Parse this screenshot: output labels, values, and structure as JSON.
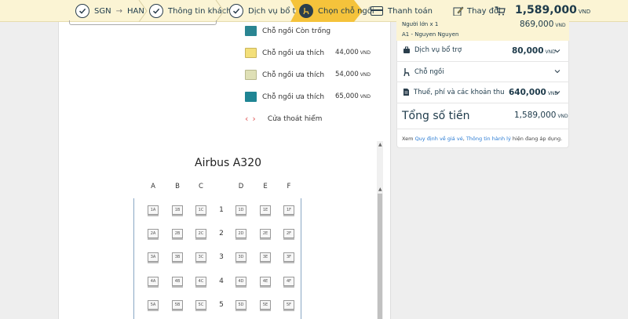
{
  "steps": {
    "route_from": "SGN",
    "route_to": "HAN",
    "passenger_info": "Thông tin khách",
    "extra_services": "Dịch vụ bổ trợ",
    "choose_seat": "Chọn chỗ ngồi",
    "payment": "Thanh toán",
    "change": "Thay đổi",
    "total": "1,589,000",
    "currency": "VND"
  },
  "legend": [
    {
      "label": "Chỗ ngồi Còn trống",
      "color": "#2a8592",
      "price": ""
    },
    {
      "label": "Chỗ ngồi ưa thích",
      "color": "#f3df7a",
      "price": "44,000"
    },
    {
      "label": "Chỗ ngồi ưa thích",
      "color": "#dfe0b6",
      "price": "54,000"
    },
    {
      "label": "Chỗ ngồi ưa thích",
      "color": "#1f8594",
      "price": "65,000"
    }
  ],
  "exit_label": "Cửa thoát hiểm",
  "aircraft": "Airbus A320",
  "columns": [
    "A",
    "B",
    "C",
    "D",
    "E",
    "F"
  ],
  "rows": [
    "1",
    "2",
    "3",
    "4",
    "5"
  ],
  "summary": {
    "pax_label": "Người lớn x 1",
    "pax_price": "869,000",
    "pax_name": "A1 - Nguyen Nguyen",
    "extra_label": "Dịch vụ bổ trợ",
    "extra_price": "80,000",
    "seat_label": "Chỗ ngồi",
    "tax_label": "Thuế, phí và các khoản thu",
    "tax_price": "640,000",
    "total_label": "Tổng số tiền",
    "total_price": "1,589,000",
    "currency": "VND",
    "note_prefix": "Xem ",
    "note_link1": "Quy định về giá vé",
    "note_sep": ", ",
    "note_link2": "Thông tin hành lý",
    "note_suffix": " hiện đang áp dụng."
  }
}
